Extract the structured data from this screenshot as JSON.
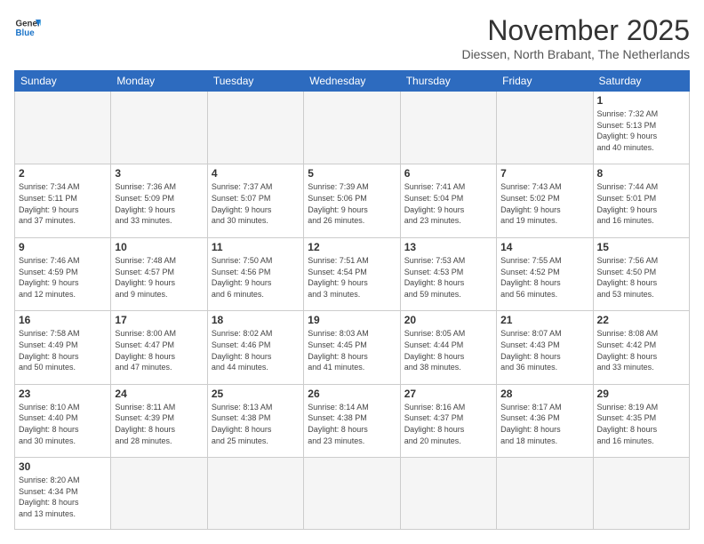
{
  "logo": {
    "line1": "General",
    "line2": "Blue"
  },
  "title": "November 2025",
  "subtitle": "Diessen, North Brabant, The Netherlands",
  "weekdays": [
    "Sunday",
    "Monday",
    "Tuesday",
    "Wednesday",
    "Thursday",
    "Friday",
    "Saturday"
  ],
  "weeks": [
    [
      {
        "day": "",
        "info": ""
      },
      {
        "day": "",
        "info": ""
      },
      {
        "day": "",
        "info": ""
      },
      {
        "day": "",
        "info": ""
      },
      {
        "day": "",
        "info": ""
      },
      {
        "day": "",
        "info": ""
      },
      {
        "day": "1",
        "info": "Sunrise: 7:32 AM\nSunset: 5:13 PM\nDaylight: 9 hours\nand 40 minutes."
      }
    ],
    [
      {
        "day": "2",
        "info": "Sunrise: 7:34 AM\nSunset: 5:11 PM\nDaylight: 9 hours\nand 37 minutes."
      },
      {
        "day": "3",
        "info": "Sunrise: 7:36 AM\nSunset: 5:09 PM\nDaylight: 9 hours\nand 33 minutes."
      },
      {
        "day": "4",
        "info": "Sunrise: 7:37 AM\nSunset: 5:07 PM\nDaylight: 9 hours\nand 30 minutes."
      },
      {
        "day": "5",
        "info": "Sunrise: 7:39 AM\nSunset: 5:06 PM\nDaylight: 9 hours\nand 26 minutes."
      },
      {
        "day": "6",
        "info": "Sunrise: 7:41 AM\nSunset: 5:04 PM\nDaylight: 9 hours\nand 23 minutes."
      },
      {
        "day": "7",
        "info": "Sunrise: 7:43 AM\nSunset: 5:02 PM\nDaylight: 9 hours\nand 19 minutes."
      },
      {
        "day": "8",
        "info": "Sunrise: 7:44 AM\nSunset: 5:01 PM\nDaylight: 9 hours\nand 16 minutes."
      }
    ],
    [
      {
        "day": "9",
        "info": "Sunrise: 7:46 AM\nSunset: 4:59 PM\nDaylight: 9 hours\nand 12 minutes."
      },
      {
        "day": "10",
        "info": "Sunrise: 7:48 AM\nSunset: 4:57 PM\nDaylight: 9 hours\nand 9 minutes."
      },
      {
        "day": "11",
        "info": "Sunrise: 7:50 AM\nSunset: 4:56 PM\nDaylight: 9 hours\nand 6 minutes."
      },
      {
        "day": "12",
        "info": "Sunrise: 7:51 AM\nSunset: 4:54 PM\nDaylight: 9 hours\nand 3 minutes."
      },
      {
        "day": "13",
        "info": "Sunrise: 7:53 AM\nSunset: 4:53 PM\nDaylight: 8 hours\nand 59 minutes."
      },
      {
        "day": "14",
        "info": "Sunrise: 7:55 AM\nSunset: 4:52 PM\nDaylight: 8 hours\nand 56 minutes."
      },
      {
        "day": "15",
        "info": "Sunrise: 7:56 AM\nSunset: 4:50 PM\nDaylight: 8 hours\nand 53 minutes."
      }
    ],
    [
      {
        "day": "16",
        "info": "Sunrise: 7:58 AM\nSunset: 4:49 PM\nDaylight: 8 hours\nand 50 minutes."
      },
      {
        "day": "17",
        "info": "Sunrise: 8:00 AM\nSunset: 4:47 PM\nDaylight: 8 hours\nand 47 minutes."
      },
      {
        "day": "18",
        "info": "Sunrise: 8:02 AM\nSunset: 4:46 PM\nDaylight: 8 hours\nand 44 minutes."
      },
      {
        "day": "19",
        "info": "Sunrise: 8:03 AM\nSunset: 4:45 PM\nDaylight: 8 hours\nand 41 minutes."
      },
      {
        "day": "20",
        "info": "Sunrise: 8:05 AM\nSunset: 4:44 PM\nDaylight: 8 hours\nand 38 minutes."
      },
      {
        "day": "21",
        "info": "Sunrise: 8:07 AM\nSunset: 4:43 PM\nDaylight: 8 hours\nand 36 minutes."
      },
      {
        "day": "22",
        "info": "Sunrise: 8:08 AM\nSunset: 4:42 PM\nDaylight: 8 hours\nand 33 minutes."
      }
    ],
    [
      {
        "day": "23",
        "info": "Sunrise: 8:10 AM\nSunset: 4:40 PM\nDaylight: 8 hours\nand 30 minutes."
      },
      {
        "day": "24",
        "info": "Sunrise: 8:11 AM\nSunset: 4:39 PM\nDaylight: 8 hours\nand 28 minutes."
      },
      {
        "day": "25",
        "info": "Sunrise: 8:13 AM\nSunset: 4:38 PM\nDaylight: 8 hours\nand 25 minutes."
      },
      {
        "day": "26",
        "info": "Sunrise: 8:14 AM\nSunset: 4:38 PM\nDaylight: 8 hours\nand 23 minutes."
      },
      {
        "day": "27",
        "info": "Sunrise: 8:16 AM\nSunset: 4:37 PM\nDaylight: 8 hours\nand 20 minutes."
      },
      {
        "day": "28",
        "info": "Sunrise: 8:17 AM\nSunset: 4:36 PM\nDaylight: 8 hours\nand 18 minutes."
      },
      {
        "day": "29",
        "info": "Sunrise: 8:19 AM\nSunset: 4:35 PM\nDaylight: 8 hours\nand 16 minutes."
      }
    ],
    [
      {
        "day": "30",
        "info": "Sunrise: 8:20 AM\nSunset: 4:34 PM\nDaylight: 8 hours\nand 13 minutes."
      },
      {
        "day": "",
        "info": ""
      },
      {
        "day": "",
        "info": ""
      },
      {
        "day": "",
        "info": ""
      },
      {
        "day": "",
        "info": ""
      },
      {
        "day": "",
        "info": ""
      },
      {
        "day": "",
        "info": ""
      }
    ]
  ]
}
